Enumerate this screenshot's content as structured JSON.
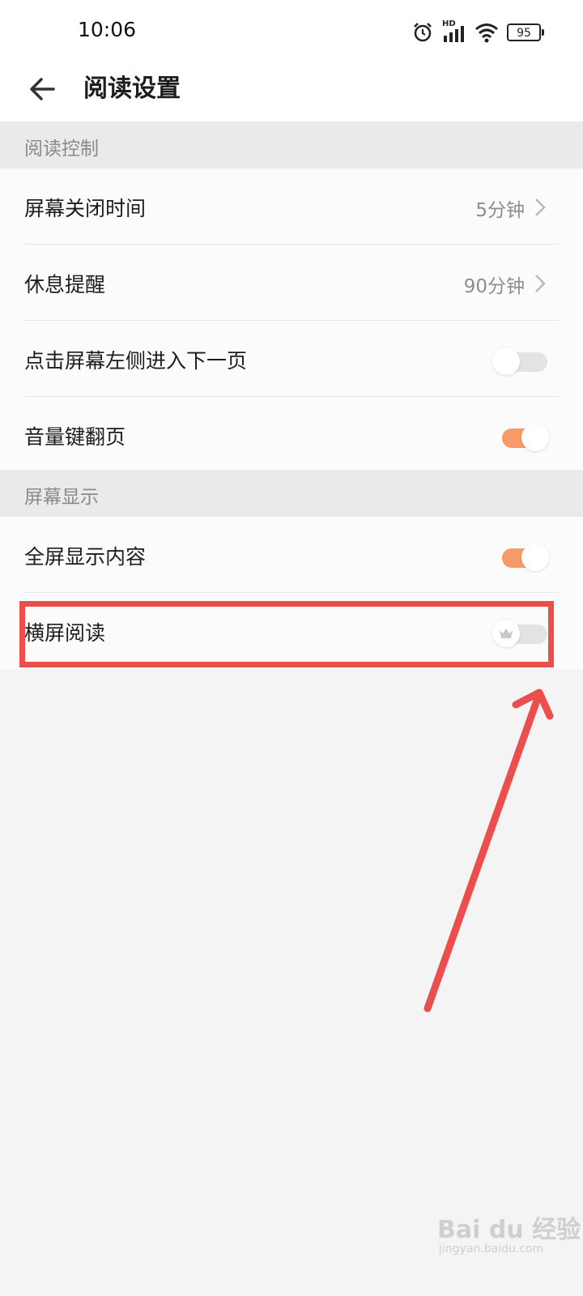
{
  "status_bar": {
    "time": "10:06",
    "network": "HD",
    "battery": "95",
    "icons": [
      "alarm-icon",
      "signal-icon",
      "wifi-icon",
      "battery-icon"
    ]
  },
  "header": {
    "title": "阅读设置",
    "back_icon": "back-arrow-icon"
  },
  "sections": [
    {
      "title": "阅读控制",
      "items": [
        {
          "label": "屏幕关闭时间",
          "value": "5分钟",
          "type": "link"
        },
        {
          "label": "休息提醒",
          "value": "90分钟",
          "type": "link"
        },
        {
          "label": "点击屏幕左侧进入下一页",
          "type": "toggle",
          "state": "off"
        },
        {
          "label": "音量键翻页",
          "type": "toggle",
          "state": "on"
        }
      ]
    },
    {
      "title": "屏幕显示",
      "items": [
        {
          "label": "全屏显示内容",
          "type": "toggle",
          "state": "on"
        },
        {
          "label": "横屏阅读",
          "type": "toggle",
          "state": "off",
          "badge_icon": "crown-icon"
        }
      ]
    }
  ],
  "colors": {
    "toggle_on": "#f79a6a",
    "toggle_off": "#e3e3e3",
    "annotation": "#ec4d4d"
  },
  "watermark": {
    "logo": "Bai du 经验",
    "url": "jingyan.baidu.com"
  }
}
